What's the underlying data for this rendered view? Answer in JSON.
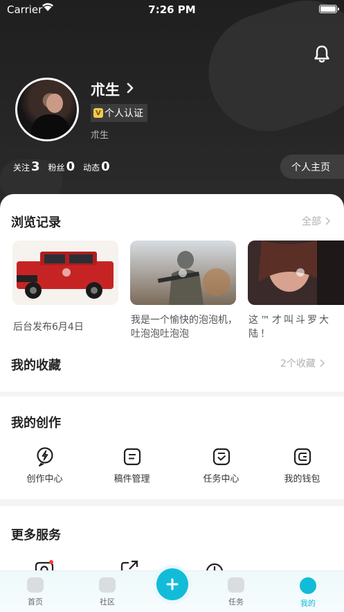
{
  "status_bar": {
    "carrier": "Carrier",
    "time": "7:26 PM"
  },
  "profile": {
    "name": "朮生",
    "verification": "个人认证",
    "verification_badge": "V",
    "subtitle": "朮生",
    "stats": [
      {
        "label": "关注",
        "value": "3"
      },
      {
        "label": "粉丝",
        "value": "0"
      },
      {
        "label": "动态",
        "value": "0"
      }
    ],
    "homepage_button": "个人主页"
  },
  "history": {
    "title": "浏览记录",
    "more": "全部",
    "items": [
      {
        "caption": "后台发布6月4日",
        "image": "red-suv-image"
      },
      {
        "caption": "我是一个愉快的泡泡机，吐泡泡吐泡泡",
        "image": "soldier-game-image"
      },
      {
        "caption": "这™才叫斗罗大陆！",
        "image": "anime-character-image"
      }
    ]
  },
  "favorites": {
    "title": "我的收藏",
    "more": "2个收藏"
  },
  "creation": {
    "title": "我的创作",
    "items": [
      {
        "label": "创作中心",
        "icon": "lightning-icon"
      },
      {
        "label": "稿件管理",
        "icon": "document-icon"
      },
      {
        "label": "任务中心",
        "icon": "task-check-icon"
      },
      {
        "label": "我的钱包",
        "icon": "wallet-icon"
      }
    ]
  },
  "services": {
    "title": "更多服务"
  },
  "tabbar": {
    "items": [
      {
        "label": "首页",
        "active": false
      },
      {
        "label": "社区",
        "active": false
      },
      {
        "label": "任务",
        "active": false
      },
      {
        "label": "我的",
        "active": true
      }
    ]
  },
  "colors": {
    "accent": "#12bcd8",
    "header_bg": "#222222"
  }
}
